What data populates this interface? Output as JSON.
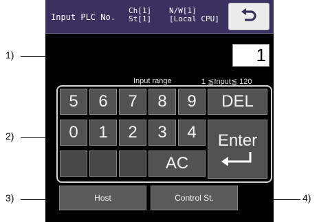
{
  "title_bar": {
    "title": "Input PLC No.",
    "ch": "Ch[1]",
    "st": "St[1]",
    "nw": "N/W[1]",
    "cpu": "[Local CPU]",
    "back_icon": "return-arrow-icon"
  },
  "input_value": "1",
  "input_range": {
    "label": "Input range",
    "value": "1 ≦Input≦ 120"
  },
  "keypad": {
    "k5": "5",
    "k6": "6",
    "k7": "7",
    "k8": "8",
    "k9": "9",
    "k0": "0",
    "k1": "1",
    "k2": "2",
    "k3": "3",
    "k4": "4",
    "del": "DEL",
    "enter": "Enter",
    "ac": "AC",
    "enter_icon": "enter-arrow-icon"
  },
  "buttons": {
    "host": "Host",
    "control_st": "Control St."
  },
  "callouts": {
    "c1": "1)",
    "c2": "2)",
    "c3": "3)",
    "c4": "4)"
  }
}
